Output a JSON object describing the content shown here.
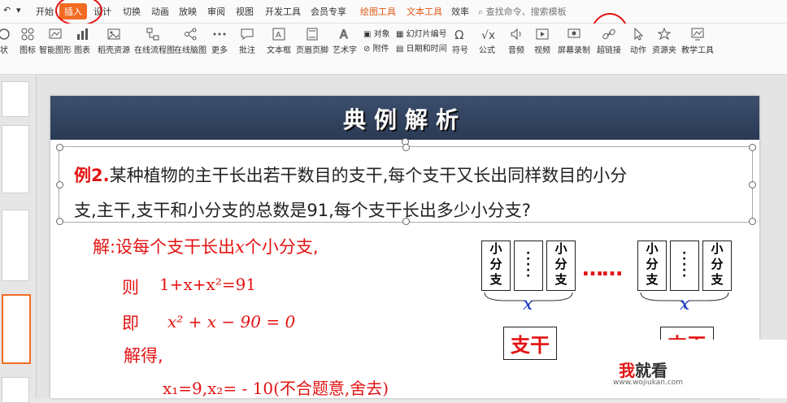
{
  "menu": {
    "items": [
      "开始",
      "插入",
      "设计",
      "切换",
      "动画",
      "放映",
      "审阅",
      "视图",
      "开发工具",
      "会员专享"
    ],
    "active_index": 1,
    "context_tabs": [
      "绘图工具",
      "文本工具"
    ],
    "efficiency": "效率",
    "search_placeholder": "查找命令、搜索模板"
  },
  "toolbar": {
    "shape": "状",
    "icons": "图标",
    "smart_art": "智能图形",
    "chart": "图表",
    "shell_resources": "稻壳资源",
    "flowchart": "在线流程图",
    "mindmap": "在线脑图",
    "more": "更多",
    "comment": "批注",
    "textbox": "文本框",
    "header_footer": "页眉页脚",
    "wordart": "艺术字",
    "object": "对象",
    "attachment": "附件",
    "slide_number": "幻灯片编号",
    "date_time": "日期和时间",
    "symbol": "符号",
    "formula": "公式",
    "audio": "音频",
    "video": "视频",
    "screen_record": "屏幕录制",
    "hyperlink": "超链接",
    "action": "动作",
    "resources": "资源夹",
    "teaching_tools": "教学工具"
  },
  "slide": {
    "title": "典例解析",
    "example_label": "例2.",
    "problem_line1": "某种植物的主干长出若干数目的支干,每个支干又长出同样数目的小分",
    "problem_line2": "支,主干,支干和小分支的总数是91,每个支干长出多少小分支?",
    "sol_line1_a": "解:设每个支干长出",
    "sol_line1_x": "x",
    "sol_line1_b": "个小分支,",
    "ze": "则",
    "eq1": "1+x+x²=91",
    "ji": "即",
    "eq2": "x² + x − 90 = 0",
    "jiede": "解得,",
    "eq3": "x₁=9,x₂= - 10(不合题意,舍去)",
    "box_text": "小分支",
    "dots": "……",
    "x_var": "x",
    "zhigan": "支干"
  },
  "watermark": {
    "wo": "我",
    "rest": "就看",
    "url": "www.wojiukan.com"
  }
}
